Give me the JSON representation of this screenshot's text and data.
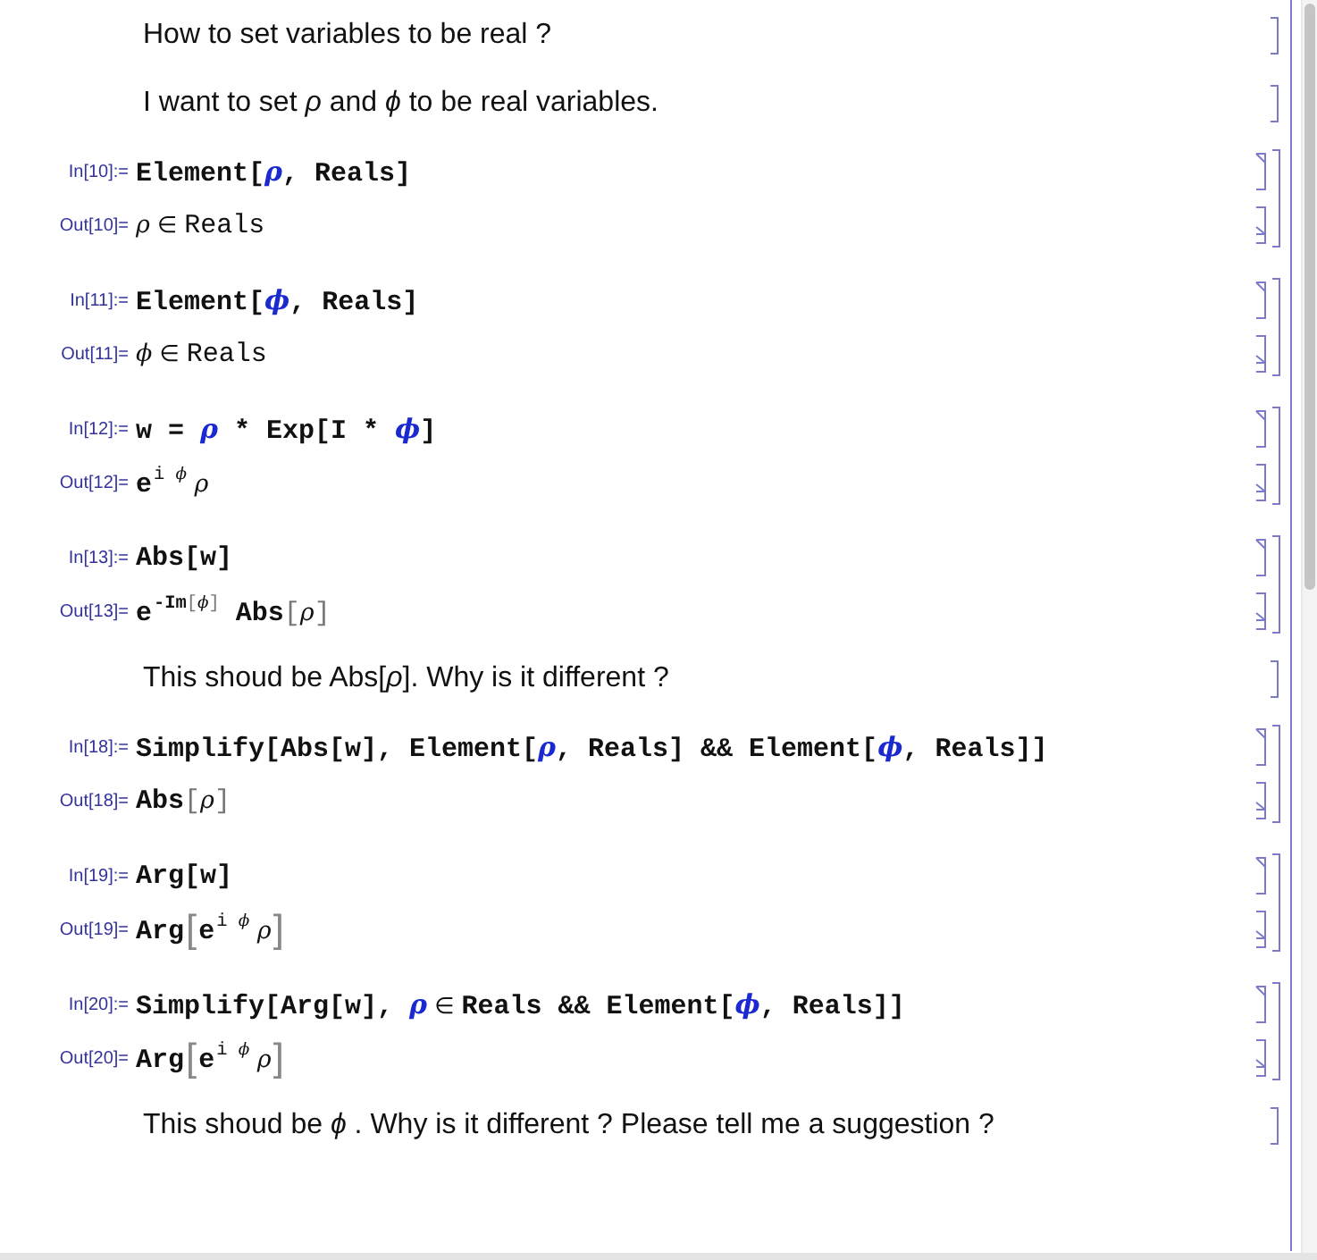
{
  "cells": [
    {
      "kind": "text",
      "text": "How to set variables to be real ?"
    },
    {
      "kind": "text",
      "text": "I want to set *ρ* and *ϕ* to be real variables."
    },
    {
      "kind": "group",
      "input": {
        "label": "In[10]:=",
        "tokens": [
          {
            "kind": "code",
            "text": "Element["
          },
          {
            "kind": "symbol",
            "text": "ρ"
          },
          {
            "kind": "code",
            "text": ", Reals]"
          }
        ]
      },
      "output": {
        "label": "Out[10]=",
        "tokens": [
          {
            "kind": "var",
            "text": "ρ"
          },
          {
            "kind": "op",
            "text": " ∈ "
          },
          {
            "kind": "plain",
            "text": "Reals"
          }
        ]
      }
    },
    {
      "kind": "group",
      "input": {
        "label": "In[11]:=",
        "tokens": [
          {
            "kind": "code",
            "text": "Element["
          },
          {
            "kind": "symbol",
            "text": "ϕ"
          },
          {
            "kind": "code",
            "text": ", Reals]"
          }
        ]
      },
      "output": {
        "label": "Out[11]=",
        "tokens": [
          {
            "kind": "var",
            "text": "ϕ"
          },
          {
            "kind": "op",
            "text": " ∈ "
          },
          {
            "kind": "plain",
            "text": "Reals"
          }
        ]
      }
    },
    {
      "kind": "group",
      "input": {
        "label": "In[12]:=",
        "tokens": [
          {
            "kind": "code",
            "text": "w = "
          },
          {
            "kind": "symbol",
            "text": "ρ"
          },
          {
            "kind": "code",
            "text": " * Exp[I * "
          },
          {
            "kind": "symbol",
            "text": "ϕ"
          },
          {
            "kind": "code",
            "text": "]"
          }
        ]
      },
      "output": {
        "label": "Out[12]=",
        "tokens": [
          {
            "kind": "code",
            "text": "e"
          },
          {
            "kind": "sup",
            "parts": [
              {
                "kind": "plain",
                "text": "i "
              },
              {
                "kind": "var",
                "text": "ϕ"
              }
            ]
          },
          {
            "kind": "var",
            "text": " ρ"
          }
        ]
      }
    },
    {
      "kind": "group",
      "input": {
        "label": "In[13]:=",
        "tokens": [
          {
            "kind": "code",
            "text": "Abs[w]"
          }
        ]
      },
      "output": {
        "label": "Out[13]=",
        "tokens": [
          {
            "kind": "code",
            "text": "e"
          },
          {
            "kind": "sup",
            "parts": [
              {
                "kind": "code",
                "text": "-Im"
              },
              {
                "kind": "bracket",
                "text": "["
              },
              {
                "kind": "var",
                "text": "ϕ"
              },
              {
                "kind": "bracket",
                "text": "]"
              }
            ]
          },
          {
            "kind": "code",
            "text": " Abs"
          },
          {
            "kind": "bracket",
            "text": "["
          },
          {
            "kind": "var",
            "text": "ρ"
          },
          {
            "kind": "bracket",
            "text": "]"
          }
        ]
      }
    },
    {
      "kind": "text",
      "text": "This shoud be Abs[*ρ*]. Why is it different ?"
    },
    {
      "kind": "group",
      "input": {
        "label": "In[18]:=",
        "tokens": [
          {
            "kind": "code",
            "text": "Simplify[Abs[w], Element["
          },
          {
            "kind": "symbol",
            "text": "ρ"
          },
          {
            "kind": "code",
            "text": ", Reals] && Element["
          },
          {
            "kind": "symbol",
            "text": "ϕ"
          },
          {
            "kind": "code",
            "text": ", Reals]]"
          }
        ]
      },
      "output": {
        "label": "Out[18]=",
        "tokens": [
          {
            "kind": "code",
            "text": "Abs"
          },
          {
            "kind": "bracket",
            "text": "["
          },
          {
            "kind": "var",
            "text": "ρ"
          },
          {
            "kind": "bracket",
            "text": "]"
          }
        ]
      }
    },
    {
      "kind": "group",
      "input": {
        "label": "In[19]:=",
        "tokens": [
          {
            "kind": "code",
            "text": "Arg[w]"
          }
        ]
      },
      "output": {
        "label": "Out[19]=",
        "tokens": [
          {
            "kind": "code",
            "text": "Arg"
          },
          {
            "kind": "bigbracket",
            "text": "["
          },
          {
            "kind": "code",
            "text": "e"
          },
          {
            "kind": "sup",
            "parts": [
              {
                "kind": "plain",
                "text": "i "
              },
              {
                "kind": "var",
                "text": "ϕ"
              }
            ]
          },
          {
            "kind": "var",
            "text": " ρ"
          },
          {
            "kind": "bigbracket",
            "text": "]"
          }
        ]
      }
    },
    {
      "kind": "group",
      "input": {
        "label": "In[20]:=",
        "tokens": [
          {
            "kind": "code",
            "text": "Simplify[Arg[w], "
          },
          {
            "kind": "symbol",
            "text": "ρ"
          },
          {
            "kind": "op",
            "text": " ∈ "
          },
          {
            "kind": "code",
            "text": "Reals && Element["
          },
          {
            "kind": "symbol",
            "text": "ϕ"
          },
          {
            "kind": "code",
            "text": ", Reals]]"
          }
        ]
      },
      "output": {
        "label": "Out[20]=",
        "tokens": [
          {
            "kind": "code",
            "text": "Arg"
          },
          {
            "kind": "bigbracket",
            "text": "["
          },
          {
            "kind": "code",
            "text": "e"
          },
          {
            "kind": "sup",
            "parts": [
              {
                "kind": "plain",
                "text": "i "
              },
              {
                "kind": "var",
                "text": "ϕ"
              }
            ]
          },
          {
            "kind": "var",
            "text": " ρ"
          },
          {
            "kind": "bigbracket",
            "text": "]"
          }
        ]
      }
    },
    {
      "kind": "text",
      "text": "This shoud be *ϕ* . Why is it different ? Please tell me a suggestion ?"
    }
  ]
}
